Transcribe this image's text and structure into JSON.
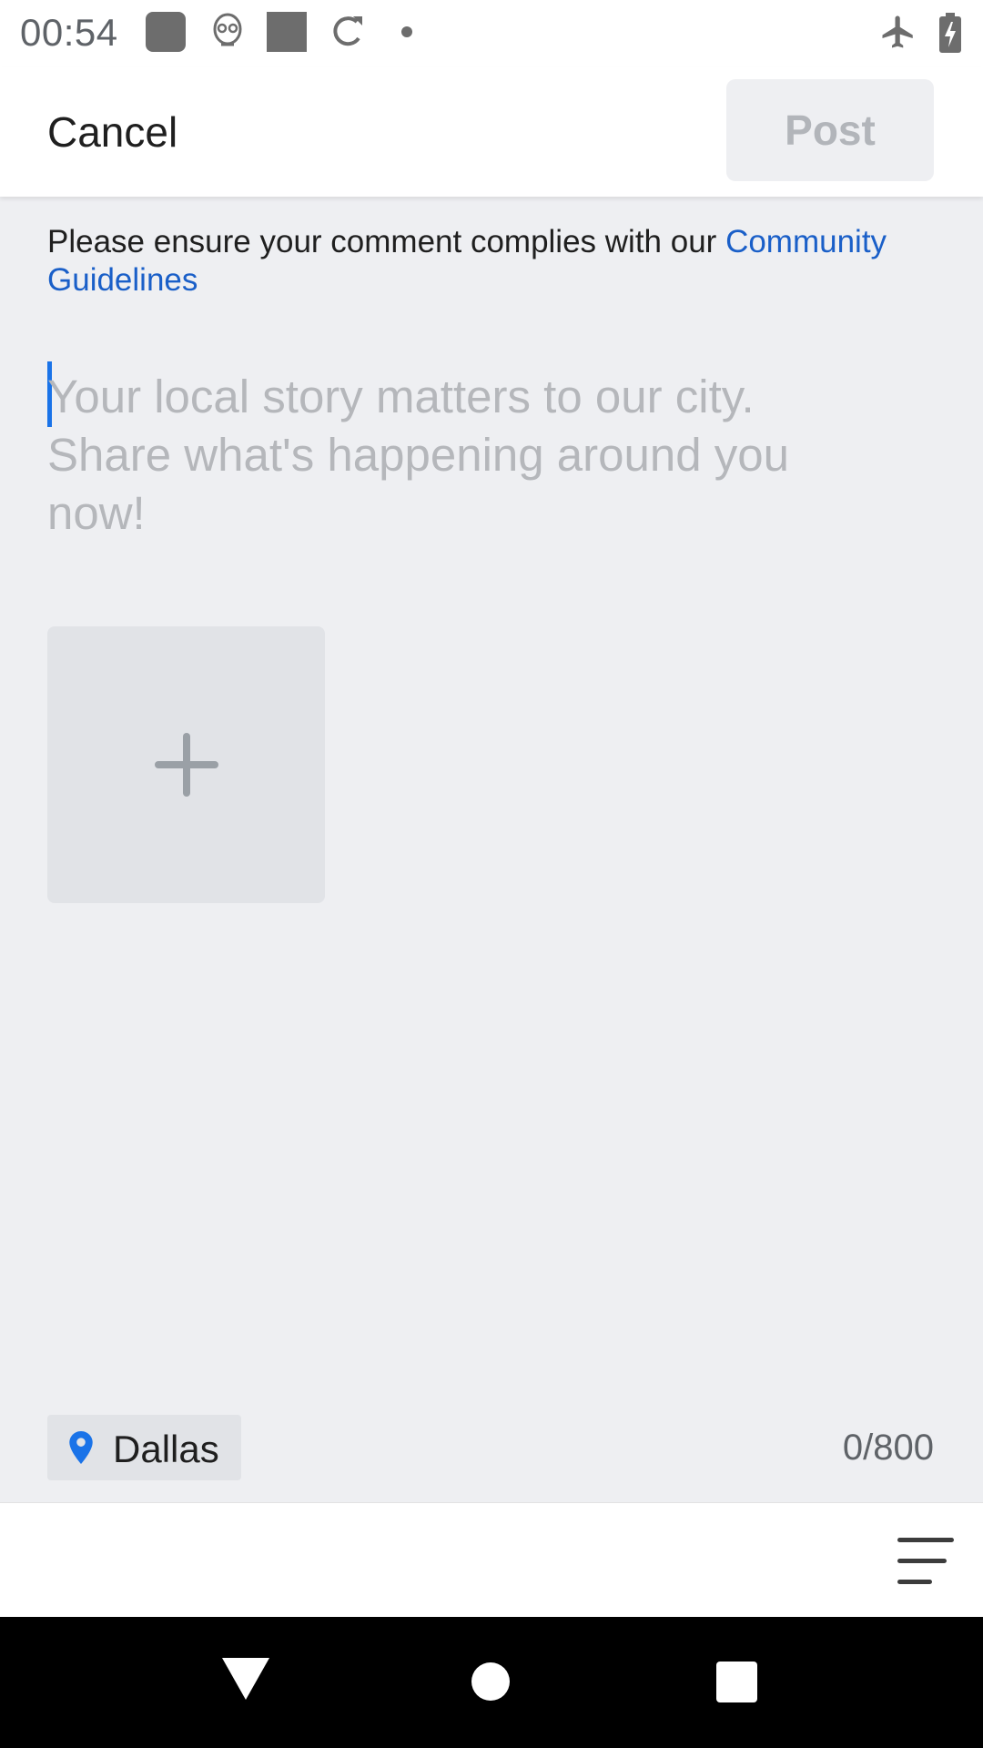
{
  "status_bar": {
    "time": "00:54",
    "icons": [
      "notification-square-icon",
      "alien-robot-icon",
      "notification-square-icon",
      "sync-icon",
      "dot-icon",
      "airplane-mode-icon",
      "battery-charging-icon"
    ]
  },
  "header": {
    "cancel_label": "Cancel",
    "post_label": "Post"
  },
  "notice": {
    "text": "Please ensure your comment complies with our ",
    "link": "Community Guidelines"
  },
  "composer": {
    "placeholder": "Your local story matters to our city. Share what's happening around you now!"
  },
  "media": {
    "add_icon": "plus-icon"
  },
  "footer": {
    "location": "Dallas",
    "location_icon": "location-pin-icon",
    "char_count": "0/800"
  },
  "toolbar": {
    "menu_icon": "menu-lines-icon"
  },
  "nav": {
    "icons": [
      "back-triangle-icon",
      "home-circle-icon",
      "recents-square-icon"
    ]
  },
  "colors": {
    "link": "#1a5fc8",
    "accent": "#1a73e8",
    "background": "#eeeff2",
    "post_disabled_text": "#b2b5ba"
  }
}
